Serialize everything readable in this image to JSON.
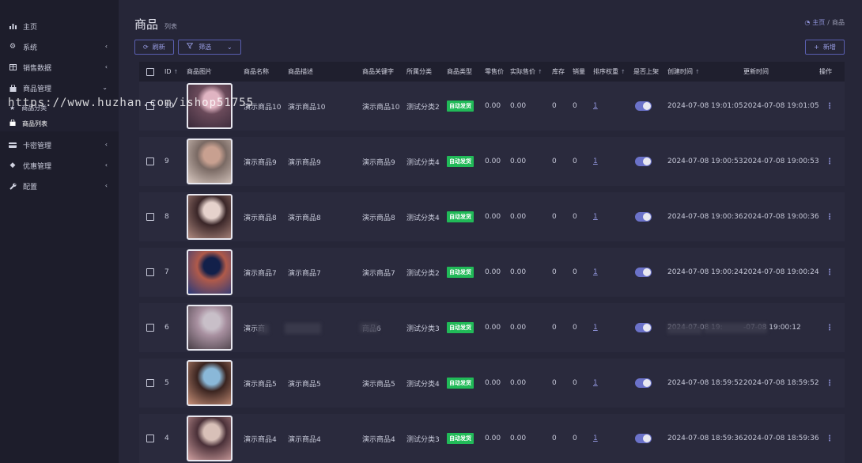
{
  "sidebar": {
    "items": [
      {
        "label": "主页",
        "icon": "bar-chart-icon",
        "has_children": false
      },
      {
        "label": "系统",
        "icon": "gear-icon",
        "has_children": true
      },
      {
        "label": "销售数据",
        "icon": "table-icon",
        "has_children": true
      },
      {
        "label": "商品管理",
        "icon": "bag-icon",
        "has_children": true,
        "expanded": true,
        "children": [
          {
            "label": "商品分类",
            "icon": "star-icon"
          },
          {
            "label": "商品列表",
            "icon": "bag-icon",
            "active": true
          }
        ]
      },
      {
        "label": "卡密管理",
        "icon": "card-icon",
        "has_children": true
      },
      {
        "label": "优惠管理",
        "icon": "diamond-icon",
        "has_children": true
      },
      {
        "label": "配置",
        "icon": "wrench-icon",
        "has_children": true
      }
    ]
  },
  "header": {
    "title": "商品",
    "subtitle": "列表"
  },
  "breadcrumb": {
    "home": "主页",
    "separator": "/",
    "current": "商品"
  },
  "toolbar": {
    "refresh_label": "刷新",
    "filter_label": "筛选",
    "add_label": "新增"
  },
  "table": {
    "columns": [
      "ID",
      "商品图片",
      "商品名称",
      "商品描述",
      "商品关键字",
      "所属分类",
      "商品类型",
      "零售价",
      "实际售价",
      "库存",
      "销量",
      "排序权重",
      "是否上架",
      "创建时间",
      "更新时间",
      "操作"
    ],
    "rows": [
      {
        "id": "10",
        "name": "演示商品10",
        "desc": "演示商品10",
        "keyword": "演示商品10",
        "category": "测试分类2",
        "type": "自动发货",
        "retail": "0.00",
        "price": "0.00",
        "stock": "0",
        "sales": "0",
        "sort": "1",
        "created": "2024-07-08 19:01:05",
        "updated": "2024-07-08 19:01:05"
      },
      {
        "id": "9",
        "name": "演示商品9",
        "desc": "演示商品9",
        "keyword": "演示商品9",
        "category": "测试分类4",
        "type": "自动发货",
        "retail": "0.00",
        "price": "0.00",
        "stock": "0",
        "sales": "0",
        "sort": "1",
        "created": "2024-07-08 19:00:53",
        "updated": "2024-07-08 19:00:53"
      },
      {
        "id": "8",
        "name": "演示商品8",
        "desc": "演示商品8",
        "keyword": "演示商品8",
        "category": "测试分类4",
        "type": "自动发货",
        "retail": "0.00",
        "price": "0.00",
        "stock": "0",
        "sales": "0",
        "sort": "1",
        "created": "2024-07-08 19:00:36",
        "updated": "2024-07-08 19:00:36"
      },
      {
        "id": "7",
        "name": "演示商品7",
        "desc": "演示商品7",
        "keyword": "演示商品7",
        "category": "测试分类2",
        "type": "自动发货",
        "retail": "0.00",
        "price": "0.00",
        "stock": "0",
        "sales": "0",
        "sort": "1",
        "created": "2024-07-08 19:00:24",
        "updated": "2024-07-08 19:00:24"
      },
      {
        "id": "6",
        "name": "演示商",
        "desc": "",
        "keyword": "商品6",
        "category": "测试分类3",
        "type": "自动发货",
        "retail": "0.00",
        "price": "0.00",
        "stock": "0",
        "sales": "0",
        "sort": "1",
        "created": "2024-07-08 19:",
        "updated": "-07-08 19:00:12"
      },
      {
        "id": "5",
        "name": "演示商品5",
        "desc": "演示商品5",
        "keyword": "演示商品5",
        "category": "测试分类4",
        "type": "自动发货",
        "retail": "0.00",
        "price": "0.00",
        "stock": "0",
        "sales": "0",
        "sort": "1",
        "created": "2024-07-08 18:59:52",
        "updated": "2024-07-08 18:59:52"
      },
      {
        "id": "4",
        "name": "演示商品4",
        "desc": "演示商品4",
        "keyword": "演示商品4",
        "category": "测试分类3",
        "type": "自动发货",
        "retail": "0.00",
        "price": "0.00",
        "stock": "0",
        "sales": "0",
        "sort": "1",
        "created": "2024-07-08 18:59:36",
        "updated": "2024-07-08 18:59:36"
      }
    ]
  },
  "watermark": "https://www.huzhan.com/ishop51755",
  "colors": {
    "accent": "#6b72c9",
    "badge": "#21ba58",
    "bg": "#262638",
    "sidebar": "#1d1d2b",
    "row": "#2a2a3d"
  }
}
